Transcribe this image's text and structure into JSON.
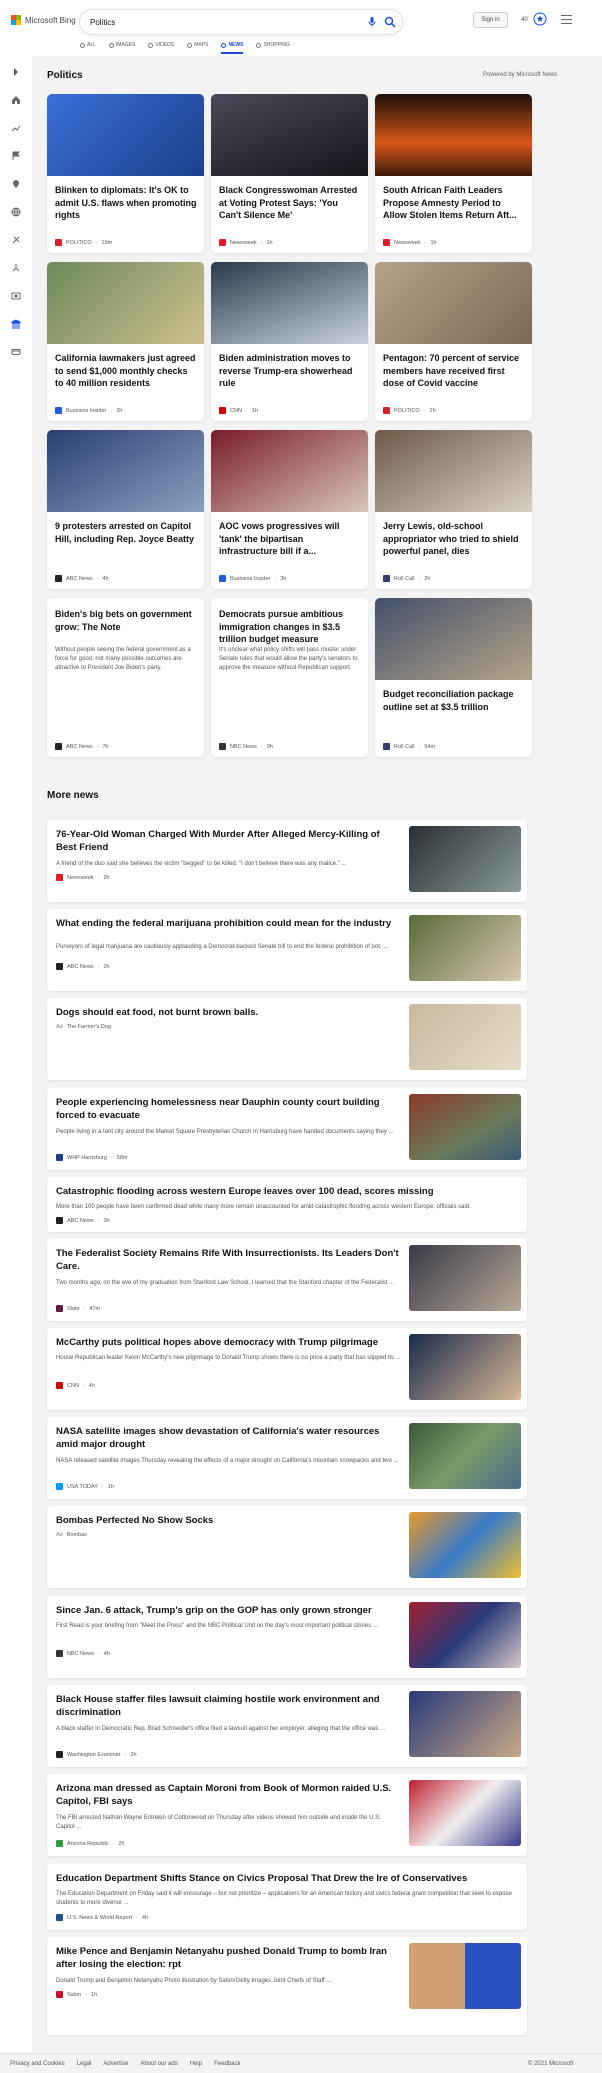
{
  "header": {
    "logo_text": "Microsoft Bing",
    "search_value": "Politics",
    "signin_label": "Sign in",
    "points": "40",
    "tabs": [
      {
        "label": "ALL"
      },
      {
        "label": "IMAGES"
      },
      {
        "label": "VIDEOS"
      },
      {
        "label": "MAPS"
      },
      {
        "label": "NEWS"
      },
      {
        "label": "SHOPPING"
      }
    ],
    "active_tab": "NEWS"
  },
  "colors": {
    "accent": "#174ae4",
    "background": "#f3f3f3"
  },
  "section": {
    "title": "Politics",
    "powered_by": "Powered by Microsoft News"
  },
  "top_cards": [
    {
      "title": "Blinken to diplomats: It's OK to admit U.S. flaws when promoting rights",
      "source": "POLITICO",
      "age": "19m",
      "icon": "politico-icon",
      "color": "#d0232a"
    },
    {
      "title": "Black Congresswoman Arrested at Voting Protest Says: 'You Can't Silence Me'",
      "source": "Newsweek",
      "age": "1h",
      "icon": "newsweek-icon",
      "color": "#e11d26"
    },
    {
      "title": "South African Faith Leaders Propose Amnesty Period to Allow Stolen Items Return Aft...",
      "source": "Newsweek",
      "age": "1h",
      "icon": "newsweek-icon",
      "color": "#e11d26"
    },
    {
      "title": "California lawmakers just agreed to send $1,000 monthly checks to 40 million residents",
      "source": "Business Insider",
      "age": "2h",
      "icon": "business-insider-icon",
      "color": "#1f5fd9"
    },
    {
      "title": "Biden administration moves to reverse Trump-era showerhead rule",
      "source": "CNN",
      "age": "1h",
      "icon": "cnn-icon",
      "color": "#cc0000"
    },
    {
      "title": "Pentagon: 70 percent of service members have received first dose of Covid vaccine",
      "source": "POLITICO",
      "age": "2h",
      "icon": "politico-icon",
      "color": "#d0232a"
    },
    {
      "title": "9 protesters arrested on Capitol Hill, including Rep. Joyce Beatty",
      "source": "ABC News",
      "age": "4h",
      "icon": "abc-news-icon",
      "color": "#222222"
    },
    {
      "title": "AOC vows progressives will 'tank' the bipartisan infrastructure bill if a...",
      "source": "Business Insider",
      "age": "3h",
      "icon": "business-insider-icon",
      "color": "#1f5fd9"
    },
    {
      "title": "Jerry Lewis, old-school appropriator who tried to shield powerful panel, dies",
      "source": "Roll Call",
      "age": "2h",
      "icon": "roll-call-icon",
      "color": "#3b3b6b"
    },
    {
      "title": "Biden's big bets on government grow: The Note",
      "desc": "Without people seeing the federal government as a force for good, not many possible outcomes are attractive to President Joe Biden's party.",
      "source": "ABC News",
      "age": "7h",
      "icon": "abc-news-icon",
      "color": "#222222"
    },
    {
      "title": "Democrats pursue ambitious immigration changes in $3.5 trillion budget measure",
      "desc": "It's unclear what policy shifts will pass muster under Senate rules that would allow the party's senators to approve the measure without Republican support.",
      "source": "NBC News",
      "age": "9h",
      "icon": "nbc-news-icon",
      "color": "#333333"
    },
    {
      "title": "Budget reconciliation package outline set at $3.5 trillion",
      "source": "Roll Call",
      "age": "54m",
      "icon": "roll-call-icon",
      "color": "#3b3b6b"
    }
  ],
  "more_news": {
    "title": "More news",
    "items": [
      {
        "title": "76-Year-Old Woman Charged With Murder After Alleged Mercy-Killing of Best Friend",
        "desc": "A friend of the duo said she believes the victim \"begged\" to be killed: \"I don't believe there was any malice.\" ...",
        "source": "Newsweek",
        "age": "2h",
        "icon": "newsweek-icon",
        "color": "#e11d26"
      },
      {
        "title": "What ending the federal marijuana prohibition could mean for the industry",
        "desc": "Purveyors of legal marijuana are cautiously applauding a Democrat-backed Senate bill to end the federal prohibition of pot, ...",
        "source": "ABC News",
        "age": "2h",
        "icon": "abc-news-icon",
        "color": "#222222"
      },
      {
        "title": "Dogs should eat food, not burnt brown balls.",
        "ad": "Ad",
        "source": "The Farmer's Dog",
        "icon": "",
        "color": ""
      },
      {
        "title": "People experiencing homelessness near Dauphin county court building forced to evacuate",
        "desc": "People living in a tent city around the Market Square Presbyterian Church in Harrisburg have handed documents saying they ...",
        "source": "WHP Harrisburg",
        "age": "58m",
        "icon": "whp-icon",
        "color": "#1d3e8f"
      },
      {
        "title": "Catastrophic flooding across western Europe leaves over 100 dead, scores missing",
        "desc": "More than 100 people have been confirmed dead while many more remain unaccounted for amid catastrophic flooding across western Europe, officials said.",
        "source": "ABC News",
        "age": "3h",
        "icon": "abc-news-icon",
        "color": "#222222"
      },
      {
        "title": "The Federalist Society Remains Rife With Insurrectionists. Its Leaders Don't Care.",
        "desc": "Two months ago, on the eve of my graduation from Stanford Law School, I learned that the Stanford chapter of the Federalist ...",
        "source": "Slate",
        "age": "47m",
        "icon": "slate-icon",
        "color": "#6b1b3b"
      },
      {
        "title": "McCarthy puts political hopes above democracy with Trump pilgrimage",
        "desc": "House Republican leader Kevin McCarthy's new pilgrimage to Donald Trump shows there is no price a party that has slipped its ...",
        "source": "CNN",
        "age": "4h",
        "icon": "cnn-icon",
        "color": "#cc0000"
      },
      {
        "title": "NASA satellite images show devastation of California's water resources amid major drought",
        "desc": "NASA released satellite images Thursday revealing the effects of a major drought on California's mountain snowpacks and two ...",
        "source": "USA TODAY",
        "age": "1h",
        "icon": "usa-today-icon",
        "color": "#009bff"
      },
      {
        "title": "Bombas Perfected No Show Socks",
        "ad": "Ad",
        "source": "Bombas",
        "icon": "",
        "color": ""
      },
      {
        "title": "Since Jan. 6 attack, Trump's grip on the GOP has only grown stronger",
        "desc": "First Read is your briefing from \"Meet the Press\" and the NBC Political Unit on the day's most important political stories ...",
        "source": "NBC News",
        "age": "4h",
        "icon": "nbc-news-icon",
        "color": "#333333"
      },
      {
        "title": "Black House staffer files lawsuit claiming hostile work environment and discrimination",
        "desc": "A black staffer in Democratic Rep. Brad Schneider's office filed a lawsuit against her employer, alleging that the office was ...",
        "source": "Washington Examiner",
        "age": "2h",
        "icon": "washington-examiner-icon",
        "color": "#222222"
      },
      {
        "title": "Arizona man dressed as Captain Moroni from Book of Mormon raided U.S. Capitol, FBI says",
        "desc": "The FBI arrested Nathan Wayne Entrekin of Cottonwood on Thursday after videos showed him outside and inside the U.S. Capitol ...",
        "source": "Arizona Republic",
        "age": "2h",
        "icon": "arizona-republic-icon",
        "color": "#2a9d3a"
      },
      {
        "title": "Education Department Shifts Stance on Civics Proposal That Drew the Ire of Conservatives",
        "desc": "The Education Department on Friday said it will encourage – but not prioritize – applications for an American history and civics federal grant competition that seek to expose students to more diverse ...",
        "source": "U.S. News & World Report",
        "age": "4h",
        "icon": "us-news-icon",
        "color": "#1d4f91"
      },
      {
        "title": "Mike Pence and Benjamin Netanyahu pushed Donald Trump to bomb Iran after losing the election: rpt",
        "desc": "Donald Trump and Benjamin Netanyahu Photo illustration by Salon/Getty Images Joint Chiefs of Staff ...",
        "source": "Salon",
        "age": "1h",
        "icon": "salon-icon",
        "color": "#c8102e"
      }
    ]
  },
  "footer": {
    "links": [
      "Privacy and Cookies",
      "Legal",
      "Advertise",
      "About our ads",
      "Help",
      "Feedback"
    ],
    "copyright": "© 2021 Microsoft"
  }
}
